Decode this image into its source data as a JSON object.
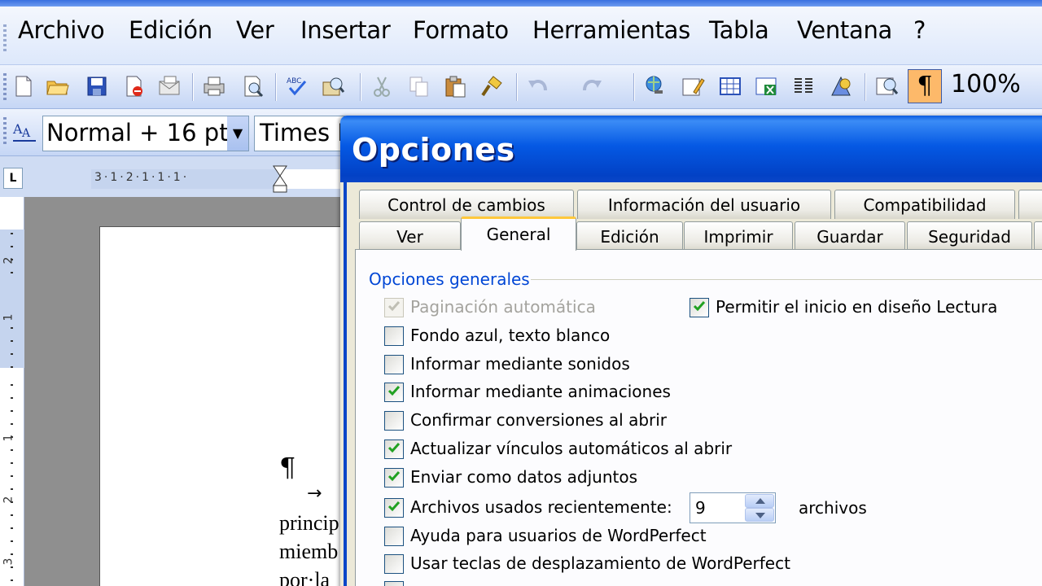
{
  "menubar": {
    "items": [
      {
        "label": "Archivo"
      },
      {
        "label": "Edición"
      },
      {
        "label": "Ver"
      },
      {
        "label": "Insertar"
      },
      {
        "label": "Formato"
      },
      {
        "label": "Herramientas"
      },
      {
        "label": "Tabla"
      },
      {
        "label": "Ventana"
      },
      {
        "label": "?"
      }
    ]
  },
  "toolbar": {
    "zoom": "100%",
    "show_formatting_marks_symbol": "¶",
    "icons": [
      "new-document-icon",
      "open-icon",
      "save-icon",
      "permission-icon",
      "email-icon",
      "print-icon",
      "print-preview-icon",
      "spelling-icon",
      "research-icon",
      "cut-icon",
      "copy-icon",
      "paste-icon",
      "format-painter-icon",
      "undo-icon",
      "redo-icon",
      "hyperlink-icon",
      "tables-borders-icon",
      "insert-table-icon",
      "insert-excel-icon",
      "columns-icon",
      "drawing-icon",
      "document-map-icon"
    ]
  },
  "formatting": {
    "style": "Normal + 16 pt",
    "font": "Times New Roman"
  },
  "ruler": {
    "corner": "L",
    "h_ticks": "3·1·2·1·1·1·",
    "v_numbers": [
      "2",
      "1",
      "1",
      "2",
      "3"
    ]
  },
  "document": {
    "pilcrow": "¶",
    "tab_arrow": "→",
    "lines": [
      "princip",
      "miemb",
      "por·la"
    ]
  },
  "dialog": {
    "title": "Opciones",
    "tabs_row1": [
      "Control de cambios",
      "Información del usuario",
      "Compatibilidad"
    ],
    "tabs_row2": [
      "Ver",
      "General",
      "Edición",
      "Imprimir",
      "Guardar",
      "Seguridad"
    ],
    "active_tab": "General",
    "group_label": "Opciones generales",
    "options": [
      {
        "label": "Paginación automática",
        "checked": true,
        "disabled": true
      },
      {
        "label": "Permitir el inicio en diseño Lectura",
        "checked": true,
        "disabled": false
      },
      {
        "label": "Fondo azul, texto blanco",
        "checked": false,
        "disabled": false
      },
      {
        "label": "Informar mediante sonidos",
        "checked": false,
        "disabled": false
      },
      {
        "label": "Informar mediante animaciones",
        "checked": true,
        "disabled": false
      },
      {
        "label": "Confirmar conversiones al abrir",
        "checked": false,
        "disabled": false
      },
      {
        "label": "Actualizar vínculos automáticos al abrir",
        "checked": true,
        "disabled": false
      },
      {
        "label": "Enviar como datos adjuntos",
        "checked": true,
        "disabled": false
      },
      {
        "label": "Archivos usados recientemente:",
        "checked": true,
        "disabled": false
      },
      {
        "label": "Ayuda para usuarios de WordPerfect",
        "checked": false,
        "disabled": false
      },
      {
        "label": "Usar teclas de desplazamiento de WordPerfect",
        "checked": false,
        "disabled": false
      }
    ],
    "recent_files_count": "9",
    "recent_files_unit": "archivos"
  },
  "colors": {
    "title_bar": "#0559e4",
    "group_label": "#0046d5",
    "active_tab_accent": "#ffc83c",
    "check_green": "#21a121"
  }
}
